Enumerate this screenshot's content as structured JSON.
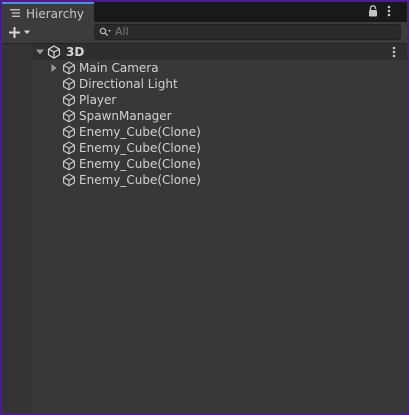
{
  "tab": {
    "title": "Hierarchy"
  },
  "search": {
    "placeholder": "All"
  },
  "scene": {
    "name": "3D"
  },
  "objects": [
    {
      "name": "Main Camera",
      "expandable": true
    },
    {
      "name": "Directional Light",
      "expandable": false
    },
    {
      "name": "Player",
      "expandable": false
    },
    {
      "name": "SpawnManager",
      "expandable": false
    },
    {
      "name": "Enemy_Cube(Clone)",
      "expandable": false
    },
    {
      "name": "Enemy_Cube(Clone)",
      "expandable": false
    },
    {
      "name": "Enemy_Cube(Clone)",
      "expandable": false
    },
    {
      "name": "Enemy_Cube(Clone)",
      "expandable": false
    }
  ],
  "colors": {
    "accent_tab": "#4b8fd6",
    "background": "#383838",
    "frame": "#4b1f8a"
  }
}
